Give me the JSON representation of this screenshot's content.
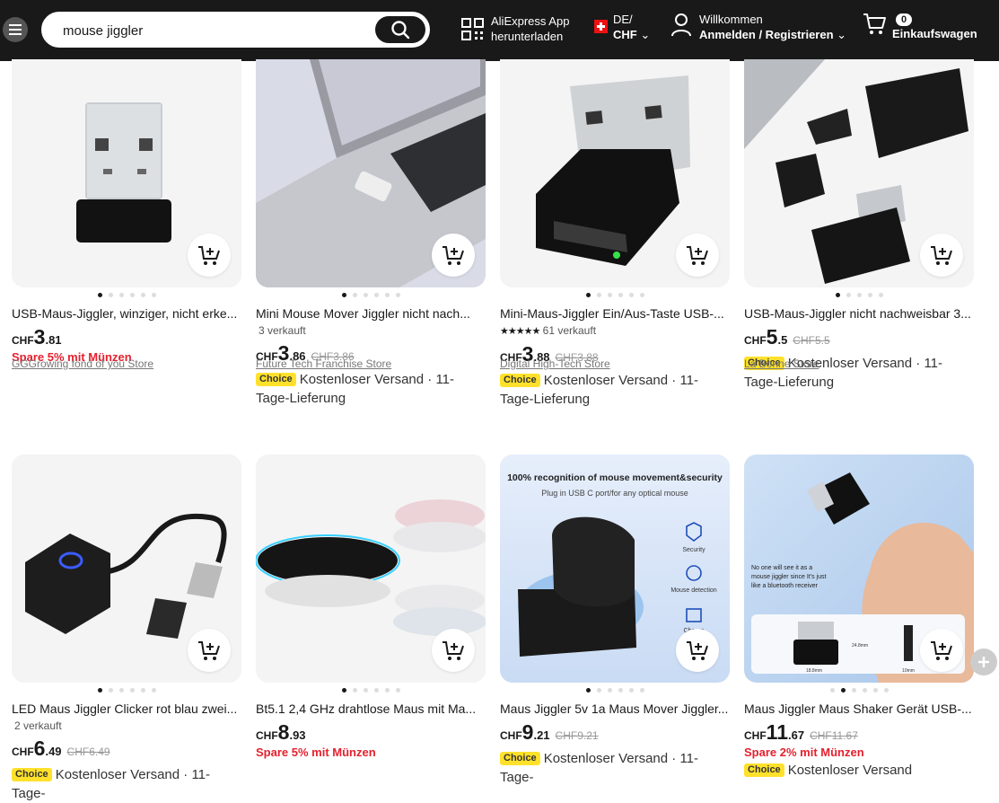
{
  "header": {
    "search_value": "mouse jiggler",
    "app_line1": "AliExpress App",
    "app_line2": "herunterladen",
    "lang_line1": "DE/",
    "lang_line2": "CHF",
    "welcome": "Willkommen",
    "signin": "Anmelden / Registrieren",
    "cart_count": "0",
    "cart_label": "Einkaufswagen"
  },
  "icons": [
    "menu-icon",
    "search-icon",
    "qr-code-icon",
    "swiss-flag-icon",
    "user-icon",
    "cart-icon",
    "add-to-cart-icon",
    "plus-icon"
  ],
  "products": [
    {
      "title": "USB-Maus-Jiggler, winziger, nicht erke...",
      "sold": "",
      "rating": "",
      "currency": "CHF",
      "price_int": "3",
      "price_dec": ".81",
      "old_price": "",
      "spare": "Spare 5% mit Münzen",
      "choice": "",
      "shipping": "",
      "store": "GGGrowing fond of you Store"
    },
    {
      "title": "Mini Mouse Mover Jiggler nicht nach...",
      "sold": "3 verkauft",
      "rating": "",
      "currency": "CHF",
      "price_int": "3",
      "price_dec": ".86",
      "old_price": "CHF3.86",
      "spare": "",
      "choice": "Choice",
      "shipping": "Kostenloser Versand · 11-Tage-Lieferung",
      "store": "Future Tech Franchise Store"
    },
    {
      "title": "Mini-Maus-Jiggler Ein/Aus-Taste USB-...",
      "sold": "61 verkauft",
      "rating": "★★★★★",
      "currency": "CHF",
      "price_int": "3",
      "price_dec": ".88",
      "old_price": "CHF3.88",
      "spare": "",
      "choice": "Choice",
      "shipping": "Kostenloser Versand · 11-Tage-Lieferung",
      "store": "Digital High-Tech Store"
    },
    {
      "title": "USB-Maus-Jiggler nicht nachweisbar 3...",
      "sold": "",
      "rating": "",
      "currency": "CHF",
      "price_int": "5",
      "price_dec": ".5",
      "old_price": "CHF5.5",
      "spare": "",
      "choice": "Choice",
      "shipping": "Kostenloser Versand · 11-Tage-Lieferung",
      "store": "La Bonne Store"
    },
    {
      "title": "LED Maus Jiggler Clicker rot blau zwei...",
      "sold": "2 verkauft",
      "rating": "",
      "currency": "CHF",
      "price_int": "6",
      "price_dec": ".49",
      "old_price": "CHF6.49",
      "spare": "",
      "choice": "Choice",
      "shipping": "Kostenloser Versand · 11-Tage-",
      "store": ""
    },
    {
      "title": "Bt5.1 2,4 GHz drahtlose Maus mit Ma...",
      "sold": "",
      "rating": "",
      "currency": "CHF",
      "price_int": "8",
      "price_dec": ".93",
      "old_price": "",
      "spare": "Spare 5% mit Münzen",
      "choice": "",
      "shipping": "",
      "store": ""
    },
    {
      "title": "Maus Jiggler 5v 1a Maus Mover Jiggler...",
      "sold": "",
      "rating": "",
      "currency": "CHF",
      "price_int": "9",
      "price_dec": ".21",
      "old_price": "CHF9.21",
      "spare": "",
      "choice": "Choice",
      "shipping": "Kostenloser Versand · 11-Tage-",
      "store": ""
    },
    {
      "title": "Maus Jiggler Maus Shaker Gerät USB-...",
      "sold": "",
      "rating": "",
      "currency": "CHF",
      "price_int": "11",
      "price_dec": ".67",
      "old_price": "CHF11.67",
      "spare": "Spare 2% mit Münzen",
      "choice": "Choice",
      "shipping": "Kostenloser Versand",
      "store": ""
    }
  ],
  "image_text": {
    "p7_line1": "100% recognition of mouse movement&security",
    "p7_line2": "Plug in USB C port/for any optical mouse",
    "p7_security": "Security",
    "p7_detect": "Mouse detection",
    "p7_charge": "Charge",
    "p8_text1": "No one will see it as a",
    "p8_text2": "mouse jiggler since  It's just",
    "p8_text3": "like a bluetooth receiver",
    "p8_dim1": "18.8mm",
    "p8_dim2": "24.8mm",
    "p8_dim3": "10mm"
  }
}
